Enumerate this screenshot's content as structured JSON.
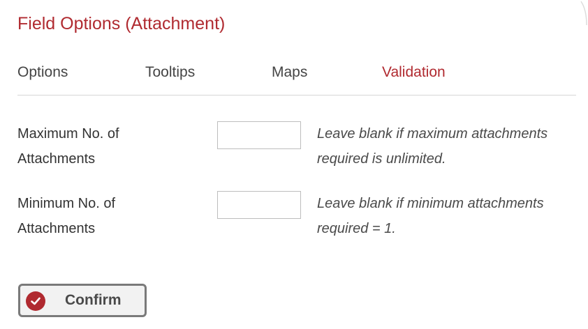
{
  "dialog": {
    "title": "Field Options (Attachment)"
  },
  "tabs": [
    {
      "label": "Options",
      "active": false
    },
    {
      "label": "Tooltips",
      "active": false
    },
    {
      "label": "Maps",
      "active": false
    },
    {
      "label": "Validation",
      "active": true
    }
  ],
  "fields": {
    "max_attachments": {
      "label": "Maximum No. of Attachments",
      "value": "",
      "hint": "Leave blank if maximum attachments required is unlimited."
    },
    "min_attachments": {
      "label": "Minimum No. of Attachments",
      "value": "",
      "hint": "Leave blank if minimum attachments required = 1."
    }
  },
  "confirm": {
    "label": "Confirm",
    "icon": "check-circle-icon"
  },
  "colors": {
    "accent": "#b02a30",
    "text": "#333333",
    "divider": "#d6d6d6",
    "button_border": "#7a7a7a"
  }
}
